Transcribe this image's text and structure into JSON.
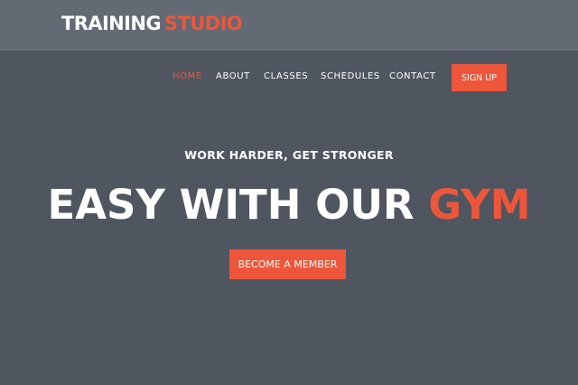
{
  "logo": {
    "part1": "TRAINING",
    "part2": "STUDIO"
  },
  "nav": {
    "items": [
      {
        "label": "HOME",
        "active": true
      },
      {
        "label": "ABOUT"
      },
      {
        "label": "CLASSES"
      },
      {
        "label": "SCHEDULES"
      },
      {
        "label": "CONTACT"
      }
    ],
    "signup_label": "SIGN UP"
  },
  "hero": {
    "subtitle": "WORK HARDER, GET STRONGER",
    "headline_main": "EASY WITH OUR",
    "headline_accent": "GYM",
    "cta_label": "BECOME A MEMBER"
  },
  "colors": {
    "accent": "#ed563b",
    "header_bg": "#636a74",
    "body_bg": "#4f5660"
  }
}
